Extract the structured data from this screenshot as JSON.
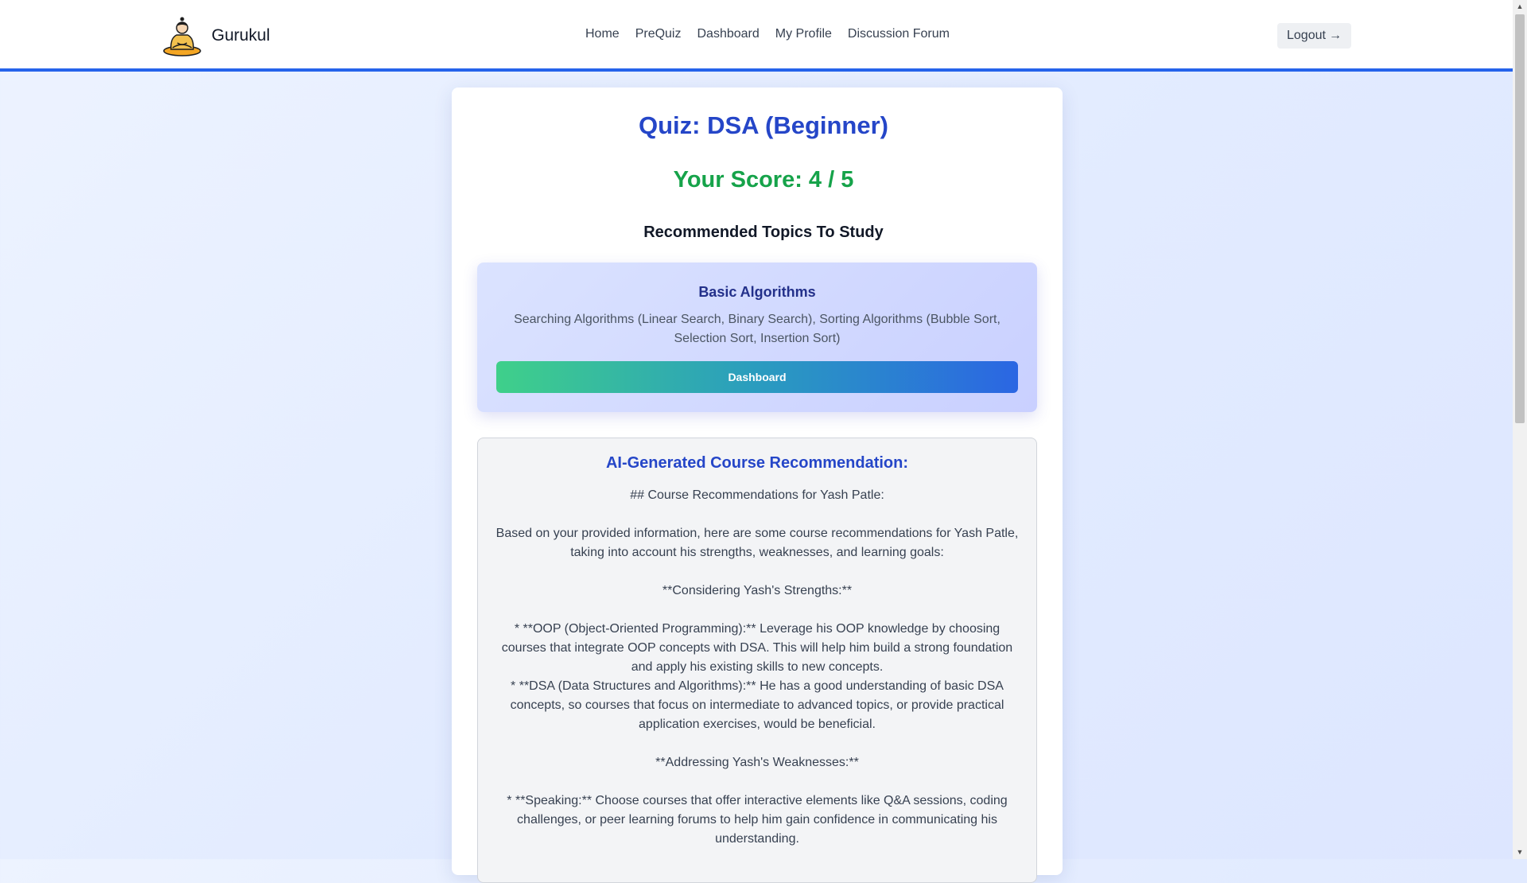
{
  "navbar": {
    "brand_name": "Gurukul",
    "logo_icon": "meditating-guru-logo",
    "links": [
      "Home",
      "PreQuiz",
      "Dashboard",
      "My Profile",
      "Discussion Forum"
    ],
    "logout_label": "Logout",
    "logout_icon": "arrow-right-icon",
    "accent_color": "#2563eb"
  },
  "quiz": {
    "title": "Quiz: DSA (Beginner)",
    "score": "Your Score: 4 / 5",
    "title_color": "#2546c8",
    "score_color": "#16a34a"
  },
  "recommended": {
    "heading": "Recommended Topics To Study",
    "topics": [
      {
        "title": "Basic Algorithms",
        "description": "Searching Algorithms (Linear Search, Binary Search), Sorting Algorithms (Bubble Sort, Selection Sort, Insertion Sort)",
        "button_label": "Dashboard"
      }
    ]
  },
  "ai_recommendation": {
    "title": "AI-Generated Course Recommendation:",
    "paragraphs": [
      "## Course Recommendations for Yash Patle:",
      "",
      "Based on your provided information, here are some course recommendations for Yash Patle, taking into account his strengths, weaknesses, and learning goals:",
      "",
      "**Considering Yash's Strengths:**",
      "",
      "* **OOP (Object-Oriented Programming):** Leverage his OOP knowledge by choosing courses that integrate OOP concepts with DSA. This will help him build a strong foundation and apply his existing skills to new concepts.",
      "* **DSA (Data Structures and Algorithms):** He has a good understanding of basic DSA concepts, so courses that focus on intermediate to advanced topics, or provide practical application exercises, would be beneficial.",
      "",
      "**Addressing Yash's Weaknesses:**",
      "",
      "* **Speaking:** Choose courses that offer interactive elements like Q&A sessions, coding challenges, or peer learning forums to help him gain confidence in communicating his understanding."
    ]
  }
}
